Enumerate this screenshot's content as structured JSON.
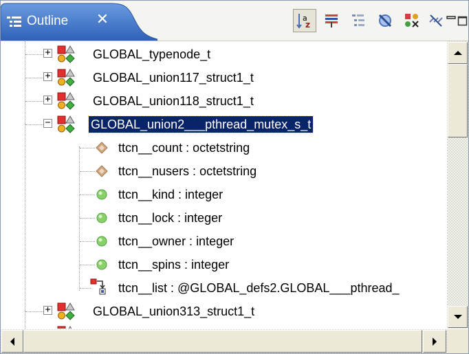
{
  "view": {
    "tab_title": "Outline",
    "close_glyph": "✕",
    "toolbar": [
      {
        "name": "sort-alphabetically-icon",
        "pressed": true
      },
      {
        "name": "hide-fields-icon",
        "pressed": false
      },
      {
        "name": "group-by-kind-icon",
        "pressed": false
      },
      {
        "name": "hide-non-public-icon",
        "pressed": false
      },
      {
        "name": "hide-static-icon",
        "pressed": false
      },
      {
        "name": "link-with-editor-icon",
        "pressed": false
      },
      {
        "name": "minimize-icon",
        "pressed": false
      },
      {
        "name": "maximize-icon",
        "pressed": false
      }
    ]
  },
  "tree": {
    "rows": [
      {
        "label": "GLOBAL_typenode_t",
        "icon": "type-icon",
        "expander": "+",
        "level": 0
      },
      {
        "label": "GLOBAL_union117_struct1_t",
        "icon": "type-icon",
        "expander": "+",
        "level": 0
      },
      {
        "label": "GLOBAL_union118_struct1_t",
        "icon": "type-icon",
        "expander": "+",
        "level": 0
      },
      {
        "label": "GLOBAL_union2___pthread_mutex_s_t",
        "icon": "type-icon",
        "expander": "-",
        "level": 0,
        "selected": true
      },
      {
        "label": "ttcn__count : octetstring",
        "icon": "diamond-field-icon",
        "level": 1
      },
      {
        "label": "ttcn__nusers : octetstring",
        "icon": "diamond-field-icon",
        "level": 1
      },
      {
        "label": "ttcn__kind : integer",
        "icon": "circle-field-icon",
        "level": 1
      },
      {
        "label": "ttcn__lock : integer",
        "icon": "circle-field-icon",
        "level": 1
      },
      {
        "label": "ttcn__owner : integer",
        "icon": "circle-field-icon",
        "level": 1
      },
      {
        "label": "ttcn__spins : integer",
        "icon": "circle-field-icon",
        "level": 1
      },
      {
        "label": "ttcn__list : @GLOBAL_defs2.GLOBAL___pthread_",
        "icon": "reference-field-icon",
        "level": 1
      },
      {
        "label": "GLOBAL_union313_struct1_t",
        "icon": "type-icon",
        "expander": "+",
        "level": 0
      },
      {
        "label": "",
        "icon": "type-icon",
        "expander": "+",
        "level": 0
      }
    ]
  },
  "colors": {
    "tab_blue": "#3a6ec4",
    "selection": "#0a246a",
    "diamond": "#c79a6f",
    "circle": "#80c860"
  }
}
